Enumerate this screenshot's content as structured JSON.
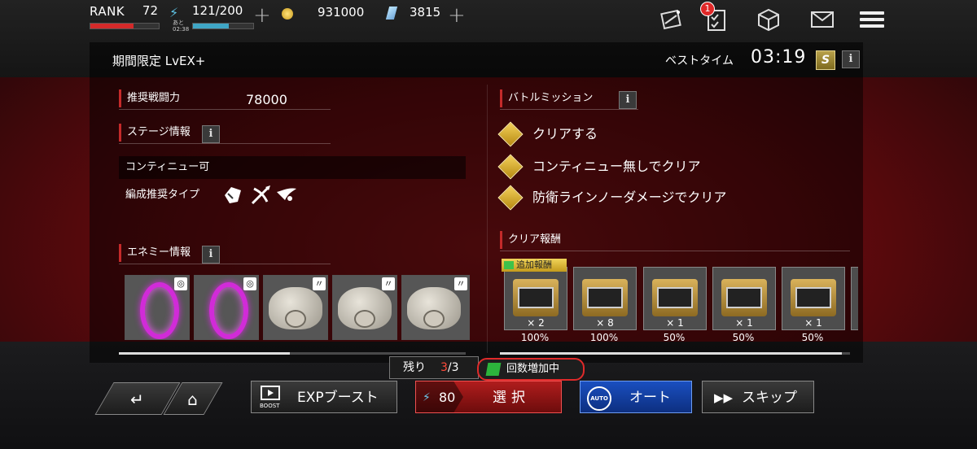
{
  "topbar": {
    "rank_label": "RANK",
    "rank_value": "72",
    "rank_progress": 0.63,
    "stamina_timer_label": "あと",
    "stamina_timer": "02:38",
    "stamina": "121/200",
    "stamina_progress": 0.6,
    "plus": "+",
    "coins": "931000",
    "gems": "3815",
    "mission_badge": "1"
  },
  "header": {
    "stage_title": "期間限定 LvEX+",
    "best_time_label": "ベストタイム",
    "best_time": "03:19",
    "rank_badge": "S",
    "info": "i"
  },
  "left": {
    "power_label": "推奨戦闘力",
    "power_value": "78000",
    "stage_info_label": "ステージ情報",
    "continue_text": "コンティニュー可",
    "type_label": "編成推奨タイプ",
    "enemy_info_label": "エネミー情報",
    "enemies": [
      {
        "kind": "portal",
        "icon": "vortex-icon"
      },
      {
        "kind": "portal",
        "icon": "vortex-icon"
      },
      {
        "kind": "bug",
        "icon": "wing-icon"
      },
      {
        "kind": "bug",
        "icon": "wing-icon"
      },
      {
        "kind": "bug",
        "icon": "wing-icon"
      }
    ]
  },
  "right": {
    "mission_label": "バトルミッション",
    "missions": [
      "クリアする",
      "コンティニュー無しでクリア",
      "防衛ラインノーダメージでクリア"
    ],
    "reward_label": "クリア報酬",
    "bonus_tag": "追加報酬",
    "rewards": [
      {
        "qty": "× 2",
        "rate": "100%"
      },
      {
        "qty": "× 8",
        "rate": "100%"
      },
      {
        "qty": "× 1",
        "rate": "50%"
      },
      {
        "qty": "× 1",
        "rate": "50%"
      },
      {
        "qty": "× 1",
        "rate": "50%"
      }
    ]
  },
  "bottom": {
    "remaining_label": "残り",
    "remaining_current": "3",
    "remaining_total": "/3",
    "increase_label": "回数増加中",
    "exp_label": "EXPブースト",
    "exp_icon_label": "BOOST",
    "cost": "80",
    "select_label": "選択",
    "auto_icon_label": "AUTO",
    "auto_label": "オート",
    "skip_label": "スキップ"
  },
  "colors": {
    "accent_red": "#c42a2a",
    "auto_blue": "#1a4fc0",
    "gold": "#f3d15a"
  }
}
